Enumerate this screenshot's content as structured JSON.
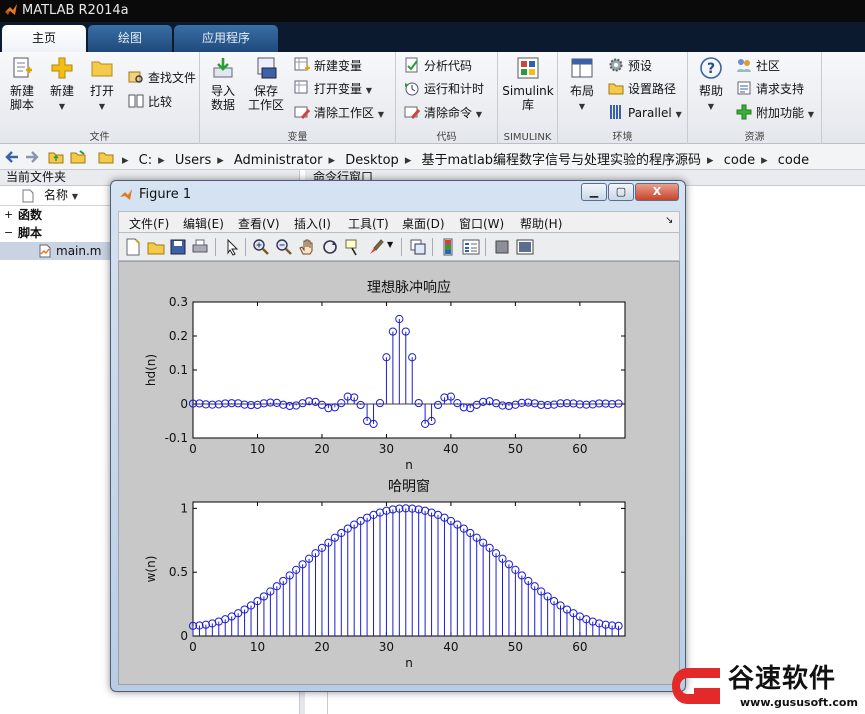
{
  "app": {
    "title": "MATLAB R2014a"
  },
  "tabs": [
    {
      "label": "主页",
      "active": true
    },
    {
      "label": "绘图",
      "active": false
    },
    {
      "label": "应用程序",
      "active": false
    }
  ],
  "ribbon": {
    "file": {
      "group": "文件",
      "new_script": "新建\n脚本",
      "new": "新建",
      "open": "打开",
      "find_files": "查找文件",
      "compare": "比较"
    },
    "variable": {
      "group": "变量",
      "import": "导入\n数据",
      "save_workspace": "保存\n工作区",
      "new_variable": "新建变量",
      "open_variable": "打开变量",
      "clear_workspace": "清除工作区"
    },
    "code": {
      "group": "代码",
      "analyze": "分析代码",
      "run_time": "运行和计时",
      "clear_commands": "清除命令"
    },
    "simulink": {
      "group": "SIMULINK",
      "label": "Simulink\n库"
    },
    "env": {
      "group": "环境",
      "layout": "布局",
      "preferences": "预设",
      "set_path": "设置路径",
      "parallel": "Parallel"
    },
    "resources": {
      "group": "资源",
      "help": "帮助",
      "community": "社区",
      "request_support": "请求支持",
      "addons": "附加功能"
    }
  },
  "address": {
    "segments": [
      "C:",
      "Users",
      "Administrator",
      "Desktop",
      "基于matlab编程数字信号与处理实验的程序源码",
      "code",
      "code"
    ]
  },
  "folder_panel": {
    "title": "当前文件夹",
    "column": "名称",
    "items": [
      {
        "label": "函数",
        "type": "group",
        "toggle": "+"
      },
      {
        "label": "脚本",
        "type": "group",
        "toggle": "−"
      },
      {
        "label": "main.m",
        "type": "file",
        "selected": true
      }
    ]
  },
  "command_window": {
    "title": "命令行窗口"
  },
  "figure": {
    "title": "Figure 1",
    "menu": [
      "文件(F)",
      "编辑(E)",
      "查看(V)",
      "插入(I)",
      "工具(T)",
      "桌面(D)",
      "窗口(W)",
      "帮助(H)"
    ],
    "min_label": "▁",
    "max_label": "▢",
    "close_label": "X"
  },
  "colors": {
    "stem": "#1c1cd6",
    "axes_bg": "#ffffff",
    "figure_bg": "#c8c8c8"
  },
  "chart_data": [
    {
      "type": "stem",
      "title": "理想脉冲响应",
      "xlabel": "n",
      "ylabel": "hd(n)",
      "xlim": [
        0,
        67
      ],
      "ylim": [
        -0.1,
        0.3
      ],
      "xticks": [
        0,
        10,
        20,
        30,
        40,
        50,
        60
      ],
      "yticks": [
        -0.1,
        0,
        0.1,
        0.2,
        0.3
      ],
      "ytick_labels": [
        "-0.1",
        "0",
        "0.1",
        "0.2",
        "0.3"
      ],
      "x_start": 0,
      "values": [
        0.005,
        0.0069,
        -0.0048,
        -0.0078,
        -0.0044,
        0.0068,
        0.0098,
        0.0081,
        -0.0075,
        -0.0127,
        -0.0102,
        0.0082,
        0.0168,
        0.0132,
        -0.009,
        -0.0228,
        -0.0176,
        0.0096,
        0.0322,
        0.0249,
        -0.0102,
        -0.049,
        -0.0388,
        0.0107,
        0.0872,
        0.0773,
        -0.011,
        -0.2,
        -0.234,
        0.011,
        0.55,
        0.852,
        1.0,
        0.852,
        0.55,
        0.011,
        -0.234,
        -0.2,
        -0.011,
        0.0773,
        0.0872,
        0.0107,
        -0.0388,
        -0.049,
        -0.0102,
        0.0249,
        0.0322,
        0.0096,
        -0.0176,
        -0.0228,
        -0.009,
        0.0132,
        0.0168,
        0.0082,
        -0.0102,
        -0.0127,
        -0.0075,
        0.0081,
        0.0098,
        0.0068,
        -0.0044,
        -0.0078,
        -0.0048,
        0.0069,
        0.005,
        -0.0019,
        0.0053
      ],
      "value_scale": 0.25
    },
    {
      "type": "stem",
      "title": "哈明窗",
      "xlabel": "n",
      "ylabel": "w(n)",
      "xlim": [
        0,
        67
      ],
      "ylim": [
        0,
        1.05
      ],
      "xticks": [
        0,
        10,
        20,
        30,
        40,
        50,
        60
      ],
      "yticks": [
        0,
        0.5,
        1
      ],
      "ytick_labels": [
        "0",
        "0.5",
        "1"
      ],
      "x_start": 0,
      "hamming_N": 67
    }
  ],
  "watermark": {
    "text": "谷速软件",
    "url": "www.gususoft.com"
  }
}
